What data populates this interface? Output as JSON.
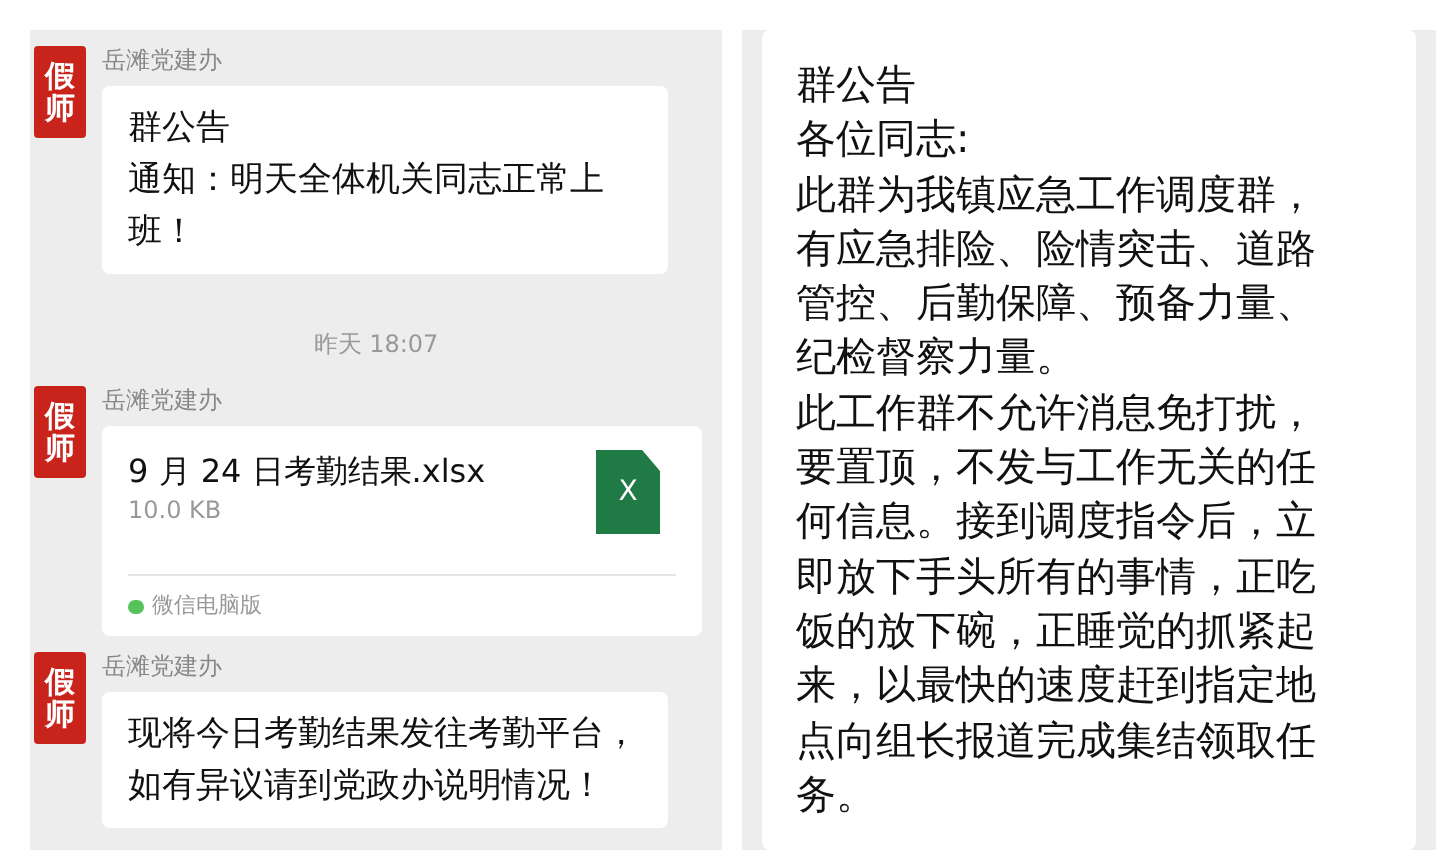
{
  "left_chat": {
    "messages": [
      {
        "kind": "text",
        "sender": "岳滩党建办",
        "avatar_text": "假师",
        "lines": [
          "群公告",
          "通知：明天全体机关同志正常上",
          "班！"
        ]
      },
      {
        "kind": "time",
        "text": "昨天 18:07"
      },
      {
        "kind": "file",
        "sender": "岳滩党建办",
        "avatar_text": "假师",
        "file_name": "9 月 24 日考勤结果.xlsx",
        "file_size": "10.0 KB",
        "file_icon_text": "X",
        "source": "微信电脑版"
      },
      {
        "kind": "text",
        "sender": "岳滩党建办",
        "avatar_text": "假师",
        "lines": [
          "现将今日考勤结果发往考勤平台，",
          "如有异议请到党政办说明情况！"
        ]
      }
    ]
  },
  "right_chat": {
    "announcement_lines": [
      "群公告",
      "各位同志:",
      "此群为我镇应急工作调度群，",
      "有应急排险、险情突击、道路",
      "管控、后勤保障、预备力量、",
      "纪检督察力量。",
      "此工作群不允许消息免打扰，",
      "要置顶，不发与工作无关的任",
      "何信息。接到调度指令后，立",
      "即放下手头所有的事情，正吃",
      "饭的放下碗，正睡觉的抓紧起",
      "来，以最快的速度赶到指定地",
      "点向组长报道完成集结领取任",
      "务。"
    ]
  }
}
